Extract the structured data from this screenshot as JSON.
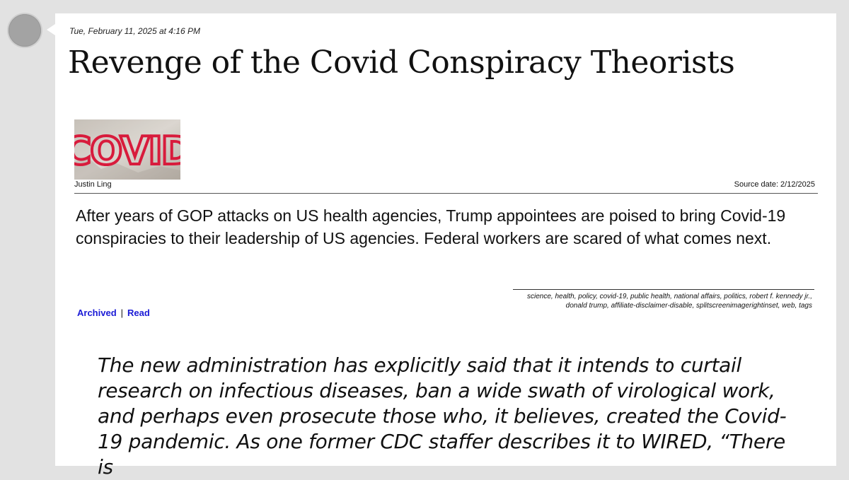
{
  "post": {
    "timestamp": "Tue, February 11, 2025 at 4:16 PM",
    "title": "Revenge of the Covid Conspiracy Theorists",
    "thumbnail_text": "COVID",
    "author": "Justin Ling",
    "source_date": "Source date: 2/12/2025",
    "summary": "After years of GOP attacks on US health agencies, Trump appointees are poised to bring Covid-19 conspiracies to their leadership of US agencies. Federal workers are scared of what comes next.",
    "links": {
      "archived": "Archived",
      "separator": "|",
      "read": "Read"
    },
    "tags": "science, health, policy, covid-19, public health, national affairs, politics, robert f. kennedy jr., donald trump, affiliate-disclaimer-disable, splitscreenimagerightinset, web, tags",
    "quote": "The new administration has explicitly said that it intends to curtail research on infectious diseases, ban a wide swath of virological work, and perhaps even prosecute those who, it believes, created the Covid-19 pandemic. As one former CDC staffer describes it to WIRED, “There is"
  },
  "colors": {
    "background": "#e2e2e2",
    "card": "#ffffff",
    "link": "#1a1ad6",
    "graffiti": "#d81b3c"
  }
}
